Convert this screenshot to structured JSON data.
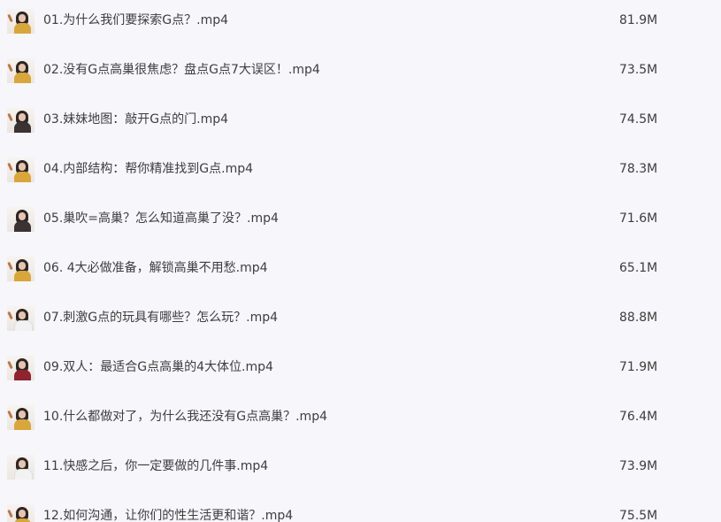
{
  "files": [
    {
      "name": "01.为什么我们要探索G点？.mp4",
      "size": "81.9M",
      "thumb_icon": "video-thumbnail"
    },
    {
      "name": "02.没有G点高巢很焦虑？盘点G点7大误区！.mp4",
      "size": "73.5M",
      "thumb_icon": "video-thumbnail"
    },
    {
      "name": "03.妹妹地图：敲开G点的门.mp4",
      "size": "74.5M",
      "thumb_icon": "video-thumbnail"
    },
    {
      "name": "04.内部结构：帮你精准找到G点.mp4",
      "size": "78.3M",
      "thumb_icon": "video-thumbnail"
    },
    {
      "name": "05.巢吹=高巢？怎么知道高巢了没？.mp4",
      "size": "71.6M",
      "thumb_icon": "video-thumbnail"
    },
    {
      "name": "06. 4大必做准备，解锁高巢不用愁.mp4",
      "size": "65.1M",
      "thumb_icon": "video-thumbnail"
    },
    {
      "name": "07.刺激G点的玩具有哪些？怎么玩？.mp4",
      "size": "88.8M",
      "thumb_icon": "video-thumbnail"
    },
    {
      "name": "09.双人：最适合G点高巢的4大体位.mp4",
      "size": "71.9M",
      "thumb_icon": "video-thumbnail"
    },
    {
      "name": "10.什么都做对了，为什么我还没有G点高巢？.mp4",
      "size": "76.4M",
      "thumb_icon": "video-thumbnail"
    },
    {
      "name": "11.快感之后，你一定要做的几件事.mp4",
      "size": "73.9M",
      "thumb_icon": "video-thumbnail"
    },
    {
      "name": "12.如何沟通，让你们的性生活更和谐？.mp4",
      "size": "75.5M",
      "thumb_icon": "video-thumbnail"
    }
  ],
  "colors": {
    "background": "#f6f6fb",
    "text": "#3e3e3e"
  }
}
